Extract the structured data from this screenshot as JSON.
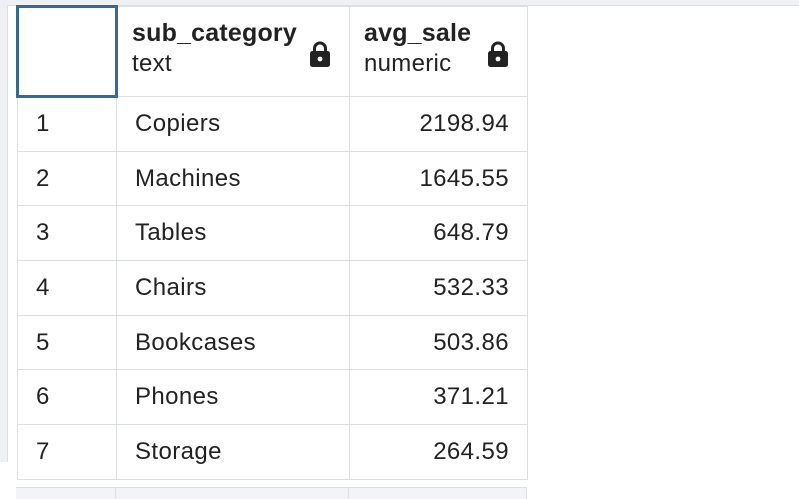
{
  "grid": {
    "columns": [
      {
        "name": "sub_category",
        "type": "text",
        "icon": "lock-icon"
      },
      {
        "name": "avg_sale",
        "type": "numeric",
        "icon": "lock-icon"
      }
    ],
    "rows": [
      {
        "index": "1",
        "sub_category": "Copiers",
        "avg_sale": "2198.94"
      },
      {
        "index": "2",
        "sub_category": "Machines",
        "avg_sale": "1645.55"
      },
      {
        "index": "3",
        "sub_category": "Tables",
        "avg_sale": "648.79"
      },
      {
        "index": "4",
        "sub_category": "Chairs",
        "avg_sale": "532.33"
      },
      {
        "index": "5",
        "sub_category": "Bookcases",
        "avg_sale": "503.86"
      },
      {
        "index": "6",
        "sub_category": "Phones",
        "avg_sale": "371.21"
      },
      {
        "index": "7",
        "sub_category": "Storage",
        "avg_sale": "264.59"
      }
    ]
  },
  "colors": {
    "selected_corner_border": "#336b96",
    "grid_line": "#dcdfe4",
    "panel_background": "#eef0f4"
  }
}
